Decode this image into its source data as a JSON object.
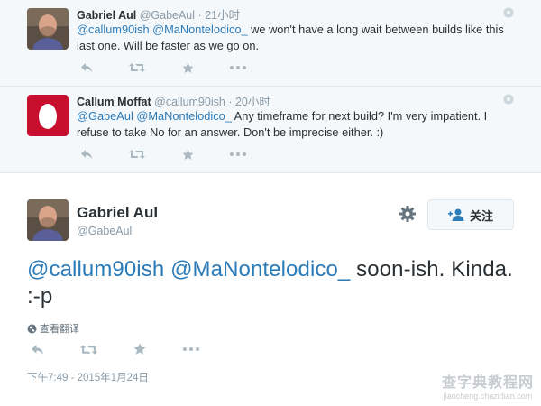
{
  "tweets": [
    {
      "name": "Gabriel Aul",
      "handle": "@GabeAul",
      "time": "21小时",
      "mentions": [
        "@callum90ish",
        "@MaNontelodico_"
      ],
      "text": " we won't have a long wait between builds like this last one. Will be faster as we go on."
    },
    {
      "name": "Callum Moffat",
      "handle": "@callum90ish",
      "time": "20小时",
      "mentions": [
        "@GabeAul",
        "@MaNontelodico_"
      ],
      "text": "  Any timeframe for next build? I'm very impatient. I refuse to take No for an answer. Don't be imprecise either. :)"
    }
  ],
  "separator": "·",
  "main": {
    "name": "Gabriel Aul",
    "handle": "@GabeAul",
    "follow_label": "关注",
    "mentions": [
      "@callum90ish",
      "@MaNontelodico_"
    ],
    "text": " soon-ish. Kinda. :-p",
    "translate_label": "查看翻译",
    "timestamp": "下午7:49 - 2015年1月24日"
  },
  "icons": {
    "reply": "reply-icon",
    "retweet": "retweet-icon",
    "favorite": "star-icon",
    "more": "more-icon",
    "gear": "gear-icon",
    "follow": "add-user-icon",
    "globe": "globe-icon"
  },
  "colors": {
    "link": "#2b7bb9",
    "muted": "#8899a6",
    "reply_bg": "#f5f8fa"
  },
  "watermark": {
    "line1": "查字典教程网",
    "line2": "jiaocheng.chazidian.com"
  }
}
